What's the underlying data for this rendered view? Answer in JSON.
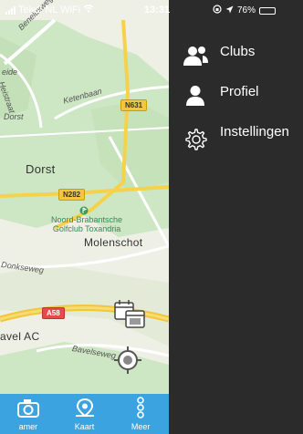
{
  "status_bar": {
    "carrier": "Tele2 NL WiFi",
    "time": "13:31",
    "battery": "76%",
    "battery_level": 0.76
  },
  "map": {
    "labels": {
      "beneluxweg": "Beneluxweg",
      "heistraat": "Heistraat",
      "eide": "eide",
      "ketenbaan": "Ketenbaan",
      "dorst_small": "Dorst",
      "dorst": "Dorst",
      "golfclub_line1": "Noord-Brabantsche",
      "golfclub_line2": "Golfclub Toxandria",
      "molenschot": "Molenschot",
      "donkseweg": "Donkseweg",
      "avel_ac": "avel AC",
      "bavelseweg": "Bavelseweg"
    },
    "roads": {
      "n631": "N631",
      "n282": "N282",
      "a58": "A58"
    }
  },
  "tabbar": {
    "tabs": [
      {
        "label": "amer",
        "icon": "camera-icon"
      },
      {
        "label": "Kaart",
        "icon": "map-pin-icon"
      },
      {
        "label": "Meer",
        "icon": "more-icon"
      }
    ]
  },
  "menu": {
    "items": [
      {
        "label": "Clubs",
        "icon": "clubs-icon"
      },
      {
        "label": "Profiel",
        "icon": "profile-icon"
      },
      {
        "label": "Instellingen",
        "icon": "settings-icon"
      }
    ]
  },
  "colors": {
    "tabbar": "#3ba4e0",
    "menu_bg": "#2b2b2b",
    "map_green": "#cde6c4",
    "highway": "#f5d24a"
  }
}
